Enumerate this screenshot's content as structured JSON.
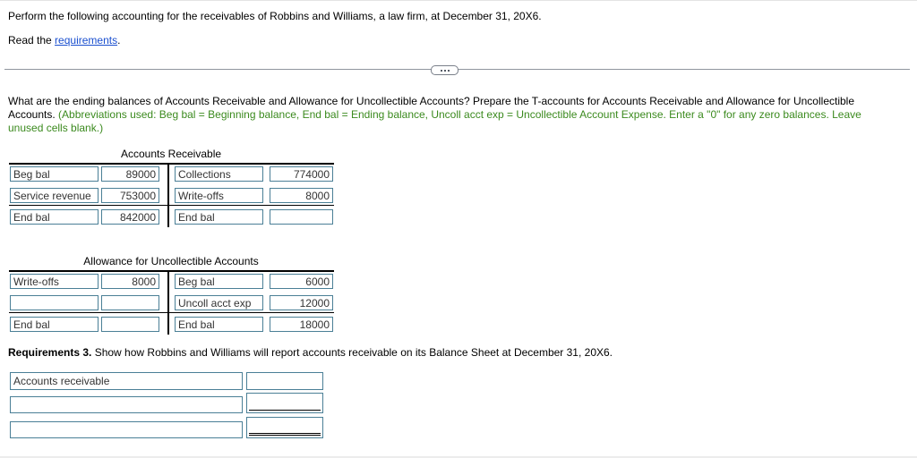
{
  "intro": {
    "text": "Perform the following accounting for the receivables of Robbins and Williams, a law firm, at December 31, 20X6.",
    "read_prefix": "Read the ",
    "read_link": "requirements",
    "read_suffix": "."
  },
  "more_button_icon": "ellipsis-icon",
  "question": {
    "main": "What are the ending balances of Accounts Receivable and Allowance for Uncollectible Accounts? Prepare the T-accounts for Accounts Receivable and Allowance for Uncollectible Accounts.",
    "note": "(Abbreviations used: Beg bal = Beginning balance, End bal = Ending balance, Uncoll acct exp = Uncollectible Account Expense. Enter a \"0\" for any zero balances. Leave unused cells blank.)"
  },
  "accounts_receivable": {
    "title": "Accounts Receivable",
    "rows": [
      {
        "dr_label": "Beg bal",
        "dr_value": "89000",
        "cr_label": "Collections",
        "cr_value": "774000"
      },
      {
        "dr_label": "Service revenue",
        "dr_value": "753000",
        "cr_label": "Write-offs",
        "cr_value": "8000"
      }
    ],
    "total": {
      "dr_label": "End bal",
      "dr_value": "842000",
      "cr_label": "End bal",
      "cr_value": ""
    }
  },
  "allowance": {
    "title": "Allowance for Uncollectible Accounts",
    "rows": [
      {
        "dr_label": "Write-offs",
        "dr_value": "8000",
        "cr_label": "Beg bal",
        "cr_value": "6000"
      },
      {
        "dr_label": "",
        "dr_value": "",
        "cr_label": "Uncoll acct exp",
        "cr_value": "12000"
      }
    ],
    "total": {
      "dr_label": "End bal",
      "dr_value": "",
      "cr_label": "End bal",
      "cr_value": "18000"
    }
  },
  "requirement3": {
    "bold": "Requirements 3.",
    "text": " Show how Robbins and Williams will report accounts receivable on its Balance Sheet at December 31, 20X6.",
    "rows": [
      {
        "label": "Accounts receivable",
        "value": ""
      },
      {
        "label": "",
        "value": ""
      },
      {
        "label": "",
        "value": ""
      }
    ]
  }
}
